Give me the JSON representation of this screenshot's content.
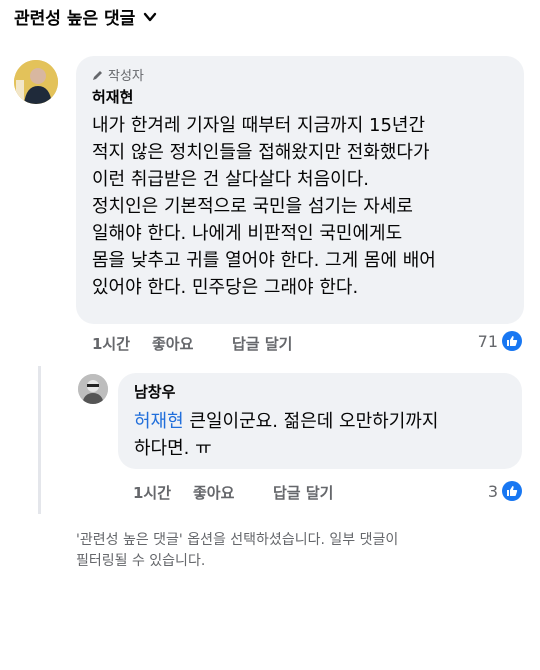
{
  "header": {
    "sort_label": "관련성 높은 댓글"
  },
  "comment": {
    "author_badge": "작성자",
    "author_name": "허재현",
    "text": "내가 한겨레 기자일 때부터 지금까지 15년간\n적지 않은 정치인들을 접해왔지만 전화했다가\n이런 취급받은 건 살다살다 처음이다.\n정치인은 기본적으로 국민을 섬기는 자세로\n일해야 한다. 나에게 비판적인 국민에게도\n몸을 낮추고 귀를 열어야 한다. 그게 몸에 배어\n있어야 한다. 민주당은 그래야 한다.",
    "time": "1시간",
    "like_label": "좋아요",
    "reply_label": "답글 달기",
    "reaction_count": "71"
  },
  "reply": {
    "author_name": "남창우",
    "mention": "허재현",
    "text": " 큰일이군요.  젊은데 오만하기까지\n하다면. ㅠ",
    "time": "1시간",
    "like_label": "좋아요",
    "reply_label": "답글 달기",
    "reaction_count": "3"
  },
  "footer": {
    "note": "'관련성 높은 댓글' 옵션을 선택하셨습니다. 일부 댓글이\n필터링될 수 있습니다."
  },
  "colors": {
    "accent": "#1877f2",
    "bubble": "#f0f2f5",
    "secondary_text": "#65676b",
    "mention": "#216fdb"
  }
}
